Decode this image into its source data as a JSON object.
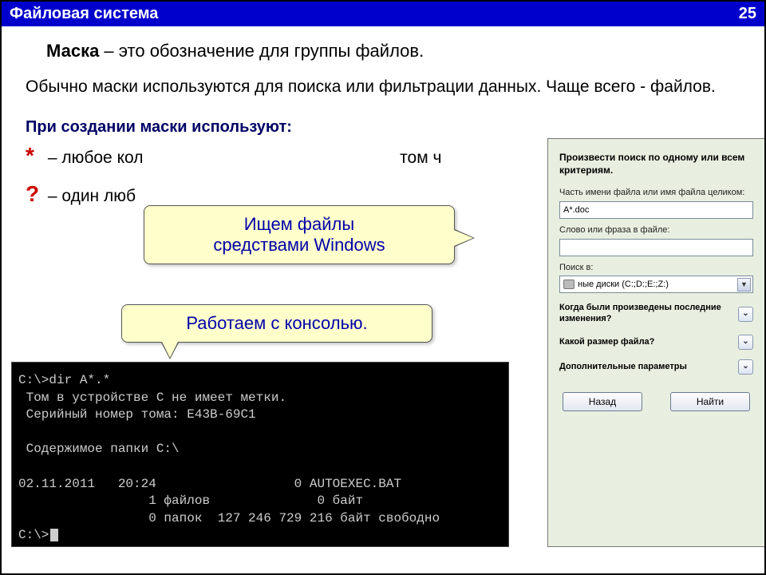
{
  "header": {
    "title": "Файловая система",
    "page": "25"
  },
  "intro": {
    "term": "Маска",
    "def": " – это обозначение для группы файлов."
  },
  "para": "Обычно маски используются для поиска или фильтрации данных. Чаще всего - файлов.",
  "sub_h": "При создании маски используют:",
  "bullets": [
    {
      "sym": "*",
      "text_before": " – любое кол",
      "text_after": "том ч"
    },
    {
      "sym": "?",
      "text_before": " – один люб",
      "text_after": ""
    }
  ],
  "callout1_l1": "Ищем файлы",
  "callout1_l2": "средствами Windows",
  "callout2": "Работаем с консолью.",
  "console": {
    "l1": "C:\\>dir A*.*",
    "l2": " Том в устройстве C не имеет метки.",
    "l3": " Серийный номер тома: E43B-69C1",
    "l4": "",
    "l5": " Содержимое папки C:\\",
    "l6": "",
    "l7": "02.11.2011   20:24                  0 AUTOEXEC.BAT",
    "l8": "                 1 файлов              0 байт",
    "l9": "                 0 папок  127 246 729 216 байт свободно",
    "l10": "C:\\>"
  },
  "panel": {
    "title": "Произвести поиск по одному или всем критериям.",
    "lbl_name": "Часть имени файла или имя файла целиком:",
    "val_name": "A*.doc",
    "lbl_phrase": "Слово или фраза в файле:",
    "val_phrase": "",
    "lbl_where": "Поиск в:",
    "val_where": "ные диски (C:;D:;E:;Z:)",
    "row1": "Когда были произведены последние изменения?",
    "row2": "Какой размер файла?",
    "row3": "Дополнительные параметры",
    "btn_back": "Назад",
    "btn_find": "Найти"
  }
}
